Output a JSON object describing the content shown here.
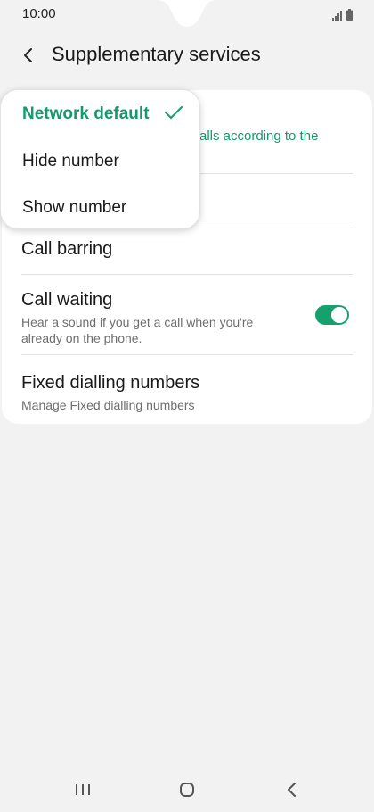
{
  "status": {
    "time": "10:00"
  },
  "header": {
    "title": "Supplementary services"
  },
  "menu": {
    "selected_desc": "alls according to the",
    "items": [
      {
        "label": "Network default",
        "selected": true
      },
      {
        "label": "Hide number",
        "selected": false
      },
      {
        "label": "Show number",
        "selected": false
      }
    ]
  },
  "settings": {
    "call_barring": {
      "label": "Call barring"
    },
    "call_waiting": {
      "label": "Call waiting",
      "desc": "Hear a sound if you get a call when you're already on the phone.",
      "enabled": true
    },
    "fixed_dialling": {
      "label": "Fixed dialling numbers",
      "desc": "Manage Fixed dialling numbers"
    }
  },
  "colors": {
    "accent": "#149a6b",
    "toggle_on": "#16a06e",
    "background": "#f2f2f2"
  },
  "icons": {
    "back": "chevron-left-icon",
    "check": "check-icon",
    "recents": "recents-icon",
    "home": "home-icon",
    "back_nav": "back-nav-icon"
  }
}
